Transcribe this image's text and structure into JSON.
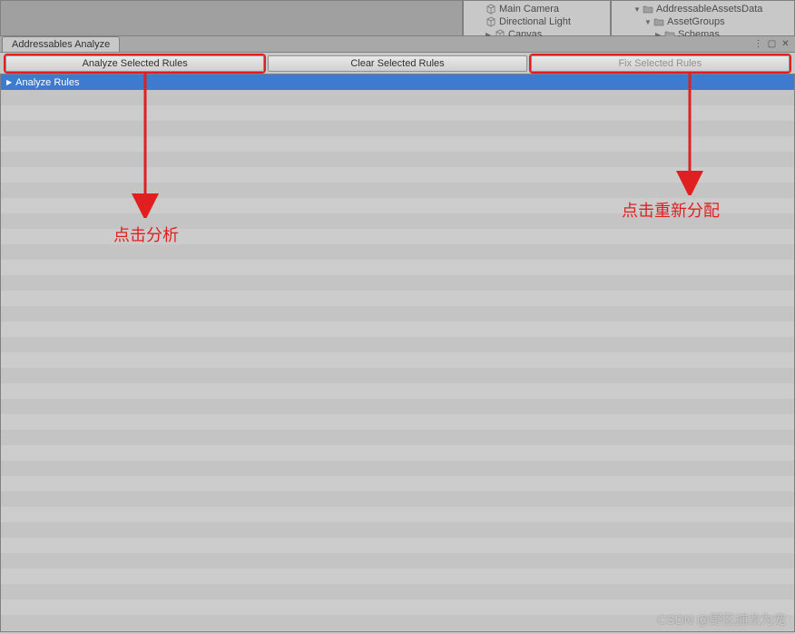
{
  "scene_hierarchy": {
    "items": [
      {
        "label": "Main Camera",
        "indent": 1,
        "icon": "cube"
      },
      {
        "label": "Directional Light",
        "indent": 1,
        "icon": "cube"
      },
      {
        "label": "Canvas",
        "indent": 1,
        "icon": "cube",
        "foldout": "▶"
      }
    ]
  },
  "project_hierarchy": {
    "items": [
      {
        "label": "AddressableAssetsData",
        "indent": 1,
        "icon": "folder",
        "foldout": "▼"
      },
      {
        "label": "AssetGroups",
        "indent": 2,
        "icon": "folder",
        "foldout": "▼"
      },
      {
        "label": "Schemas",
        "indent": 3,
        "icon": "folder",
        "foldout": "▶"
      }
    ]
  },
  "panel": {
    "tab_label": "Addressables Analyze"
  },
  "toolbar": {
    "analyze_label": "Analyze Selected Rules",
    "clear_label": "Clear Selected Rules",
    "fix_label": "Fix Selected Rules"
  },
  "list": {
    "header": "Analyze Rules"
  },
  "annotations": {
    "left_text": "点击分析",
    "right_text": "点击重新分配"
  },
  "watermark": "CSDN @野区捕龙为宠"
}
